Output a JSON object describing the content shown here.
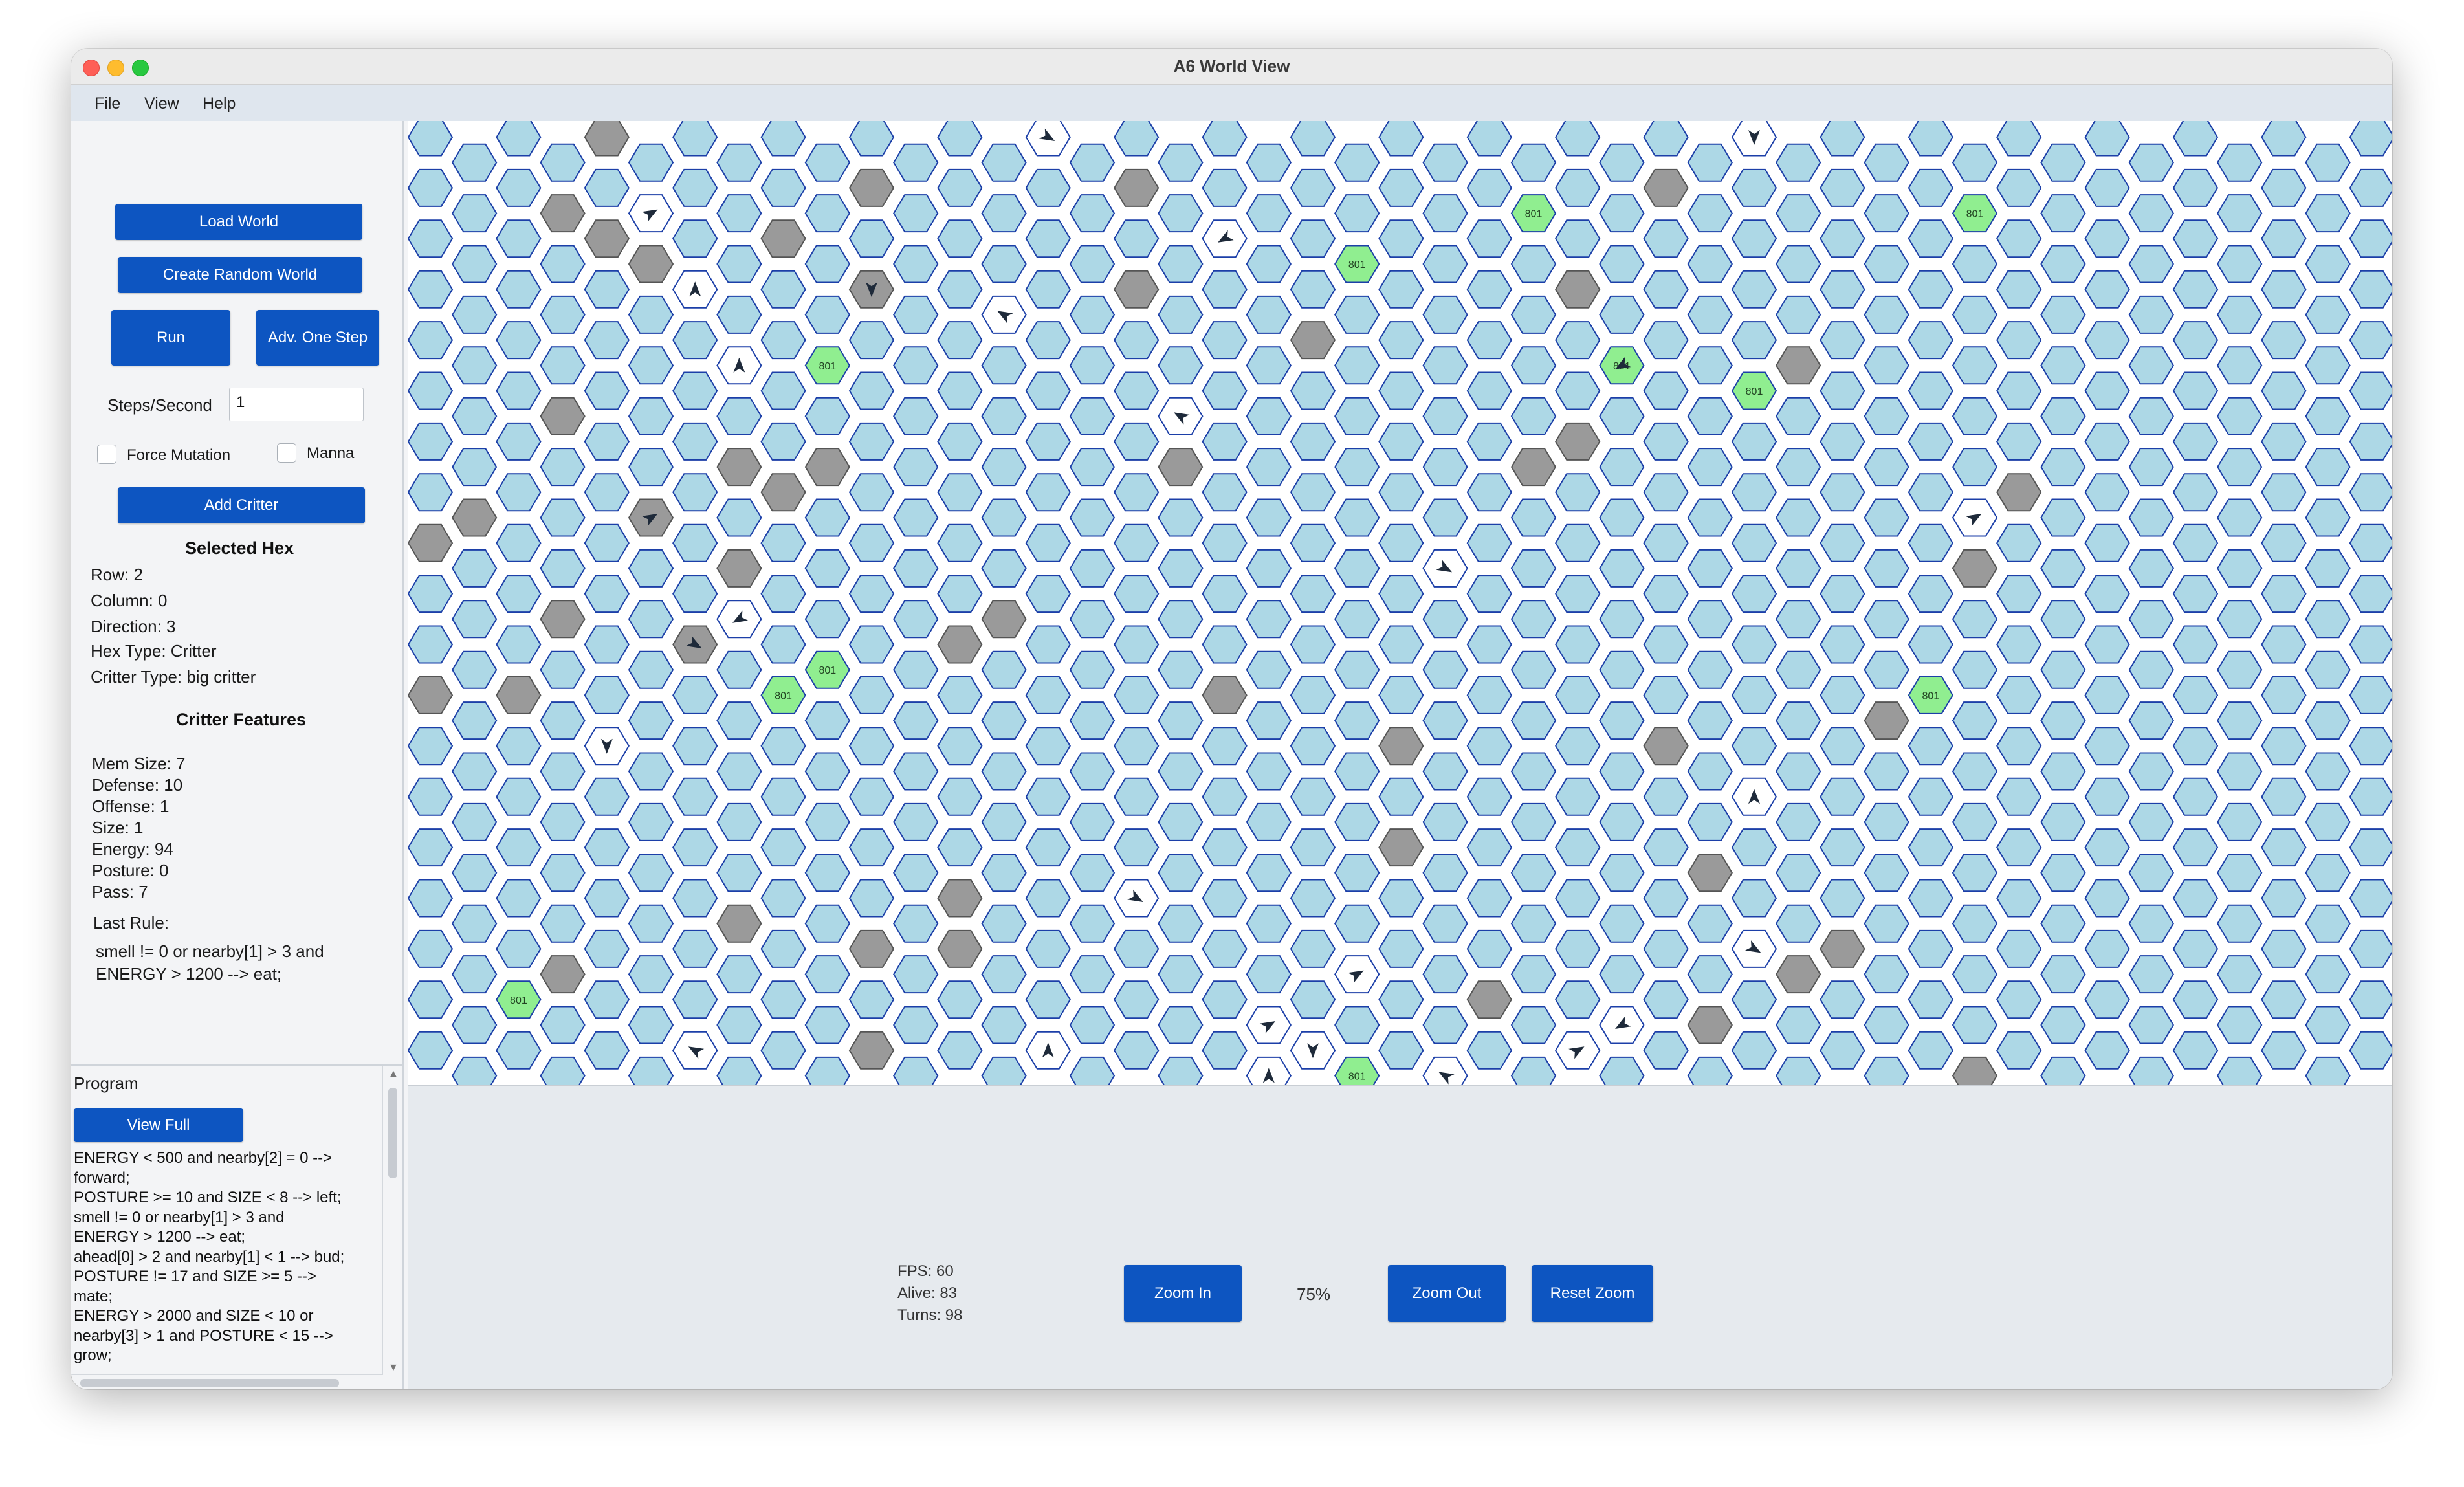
{
  "window": {
    "title": "A6 World View"
  },
  "menu": {
    "items": [
      "File",
      "View",
      "Help"
    ]
  },
  "controls": {
    "load_world": "Load World",
    "create_random_world": "Create Random World",
    "run": "Run",
    "adv_one_step": "Adv. One Step",
    "steps_label": "Steps/Second",
    "steps_value": "1",
    "force_mutation": "Force Mutation",
    "manna": "Manna",
    "add_critter": "Add Critter"
  },
  "selected_hex": {
    "heading": "Selected Hex",
    "row": "Row: 2",
    "column": "Column: 0",
    "direction": "Direction: 3",
    "hex_type": "Hex Type: Critter",
    "critter_type": "Critter Type: big critter"
  },
  "critter_features": {
    "heading": "Critter Features",
    "mem_size": "Mem Size: 7",
    "defense": "Defense: 10",
    "offense": "Offense: 1",
    "size": "Size: 1",
    "energy": "Energy: 94",
    "posture": "Posture: 0",
    "pass": "Pass: 7",
    "last_rule_label": "Last Rule:",
    "last_rule": "smell != 0 or nearby[1] > 3 and\nENERGY > 1200 --> eat;"
  },
  "program": {
    "title": "Program",
    "view_full": "View Full",
    "text": "ENERGY < 500 and nearby[2] = 0 -->\nforward;\nPOSTURE >= 10 and SIZE < 8 --> left;\nsmell != 0 or nearby[1] > 3 and\nENERGY > 1200 --> eat;\nahead[0] > 2 and nearby[1] < 1 --> bud;\nPOSTURE != 17 and SIZE >= 5 -->\nmate;\nENERGY > 2000 and SIZE < 10 or\nnearby[3] > 1 and POSTURE < 15 -->\ngrow;"
  },
  "stats": {
    "fps": "FPS: 60",
    "alive": "Alive: 83",
    "turns": "Turns: 98"
  },
  "zoom": {
    "zoom_in": "Zoom In",
    "level": "75%",
    "zoom_out": "Zoom Out",
    "reset": "Reset Zoom"
  },
  "grid": {
    "food_label": "801",
    "colors": {
      "empty": "#add8e6",
      "rock": "#9a9a9a",
      "food": "#90ee90",
      "critter": "#ffffff",
      "outline": "#1c3fa8",
      "selected_outline": "#0a1f8f"
    },
    "rocks": [
      [
        4,
        0
      ],
      [
        3,
        1
      ],
      [
        10,
        1
      ],
      [
        16,
        1
      ],
      [
        28,
        1
      ],
      [
        4,
        2
      ],
      [
        5,
        2
      ],
      [
        8,
        2
      ],
      [
        10,
        3
      ],
      [
        16,
        3
      ],
      [
        26,
        3
      ],
      [
        20,
        4
      ],
      [
        31,
        4
      ],
      [
        3,
        5
      ],
      [
        7,
        6
      ],
      [
        9,
        6
      ],
      [
        17,
        6
      ],
      [
        25,
        6
      ],
      [
        26,
        6
      ],
      [
        1,
        7
      ],
      [
        5,
        7
      ],
      [
        8,
        7
      ],
      [
        36,
        7
      ],
      [
        0,
        8
      ],
      [
        7,
        8
      ],
      [
        35,
        8
      ],
      [
        3,
        9
      ],
      [
        13,
        9
      ],
      [
        6,
        10
      ],
      [
        12,
        10
      ],
      [
        0,
        11
      ],
      [
        2,
        11
      ],
      [
        18,
        11
      ],
      [
        33,
        11
      ],
      [
        22,
        12
      ],
      [
        28,
        12
      ],
      [
        22,
        14
      ],
      [
        29,
        14
      ],
      [
        7,
        15
      ],
      [
        12,
        15
      ],
      [
        3,
        16
      ],
      [
        10,
        16
      ],
      [
        12,
        16
      ],
      [
        31,
        16
      ],
      [
        32,
        16
      ],
      [
        24,
        17
      ],
      [
        29,
        17
      ],
      [
        10,
        18
      ],
      [
        35,
        18
      ],
      [
        29,
        19
      ],
      [
        21,
        20
      ],
      [
        18,
        21
      ],
      [
        23,
        21
      ],
      [
        24,
        23
      ],
      [
        1,
        24
      ],
      [
        14,
        24
      ],
      [
        17,
        24
      ],
      [
        25,
        24
      ],
      [
        33,
        24
      ],
      [
        36,
        24
      ],
      [
        13,
        25
      ],
      [
        24,
        25
      ],
      [
        19,
        26
      ],
      [
        25,
        26
      ],
      [
        33,
        26
      ],
      [
        35,
        26
      ],
      [
        13,
        27
      ],
      [
        10,
        28
      ],
      [
        20,
        28
      ],
      [
        34,
        28
      ],
      [
        10,
        29
      ],
      [
        21,
        30
      ],
      [
        29,
        30
      ]
    ],
    "food": [
      [
        25,
        1
      ],
      [
        35,
        1
      ],
      [
        21,
        2
      ],
      [
        9,
        4
      ],
      [
        27,
        4
      ],
      [
        30,
        5
      ],
      [
        9,
        10
      ],
      [
        8,
        11
      ],
      [
        34,
        11
      ],
      [
        2,
        17
      ],
      [
        21,
        18
      ],
      [
        5,
        19
      ]
    ],
    "critters": [
      [
        5,
        1,
        1
      ],
      [
        14,
        0,
        2
      ],
      [
        30,
        0,
        3
      ],
      [
        18,
        2,
        4
      ],
      [
        6,
        3,
        0
      ],
      [
        10,
        3,
        3
      ],
      [
        13,
        3,
        5
      ],
      [
        7,
        4,
        0
      ],
      [
        27,
        4,
        4
      ],
      [
        17,
        5,
        5
      ],
      [
        5,
        7,
        1
      ],
      [
        35,
        7,
        1
      ],
      [
        23,
        8,
        2
      ],
      [
        7,
        9,
        4
      ],
      [
        6,
        10,
        2
      ],
      [
        4,
        12,
        3
      ],
      [
        30,
        13,
        0
      ],
      [
        16,
        15,
        2
      ],
      [
        21,
        16,
        1
      ],
      [
        30,
        16,
        2
      ],
      [
        19,
        17,
        1
      ],
      [
        27,
        17,
        4
      ],
      [
        23,
        18,
        5
      ],
      [
        19,
        18,
        0
      ],
      [
        26,
        18,
        1
      ],
      [
        20,
        18,
        3
      ],
      [
        16,
        19,
        4
      ],
      [
        14,
        18,
        0
      ],
      [
        6,
        18,
        5
      ],
      [
        7,
        19,
        3
      ],
      [
        29,
        19,
        0
      ],
      [
        33,
        19,
        2
      ],
      [
        28,
        19,
        3
      ],
      [
        24,
        20,
        5
      ],
      [
        31,
        20,
        1
      ],
      [
        30,
        21,
        3
      ]
    ],
    "selected": [
      0,
      23,
      3
    ]
  }
}
